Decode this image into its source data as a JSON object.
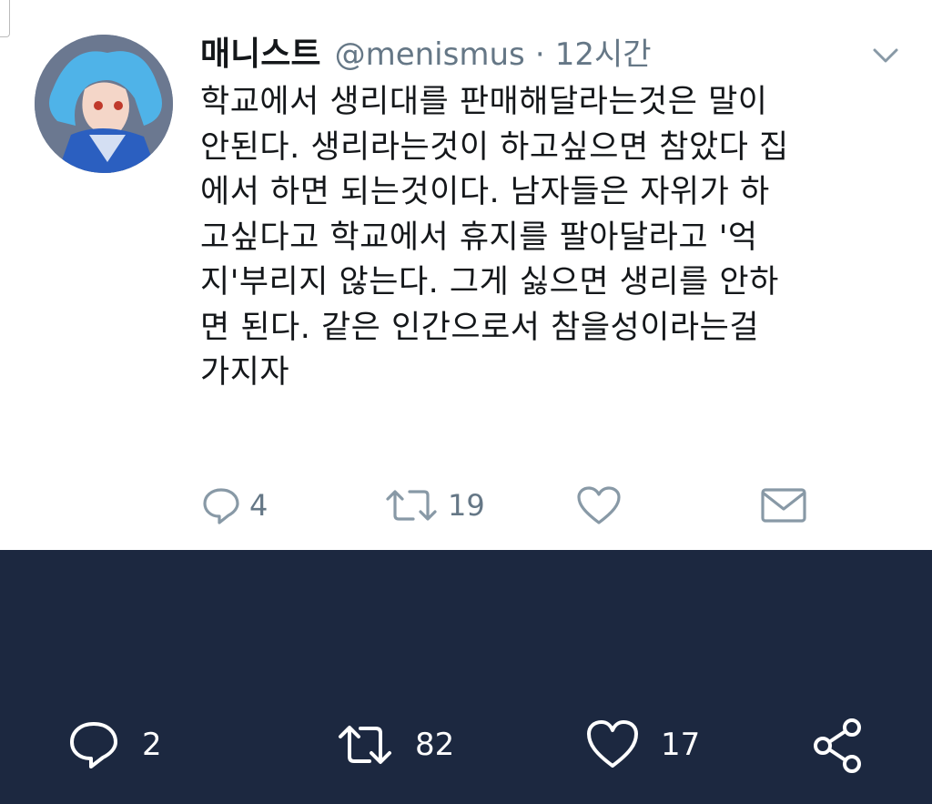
{
  "tweet": {
    "display_name": "매니스트",
    "handle": "@menismus",
    "separator": "·",
    "time": "12시간",
    "text": "학교에서 생리대를 판매해달라는것은 말이\n안된다. 생리라는것이 하고싶으면 참았다 집\n에서 하면 되는것이다. 남자들은 자위가 하\n고싶다고 학교에서 휴지를 팔아달라고 '억\n지'부리지 않는다. 그게 싫으면 생리를 안하\n면 된다. 같은 인간으로서 참을성이라는걸\n가지자",
    "actions": {
      "reply_count": "4",
      "retweet_count": "19",
      "like_count": "",
      "dm_label": ""
    }
  },
  "bottom_bar": {
    "reply_count": "2",
    "retweet_count": "82",
    "like_count": "17"
  },
  "colors": {
    "text": "#14171a",
    "secondary": "#657786",
    "bar_bg": "#1c2840"
  },
  "icons": [
    "avatar-image",
    "chevron-down-icon",
    "reply-icon",
    "retweet-icon",
    "heart-icon",
    "mail-icon",
    "share-icon"
  ]
}
